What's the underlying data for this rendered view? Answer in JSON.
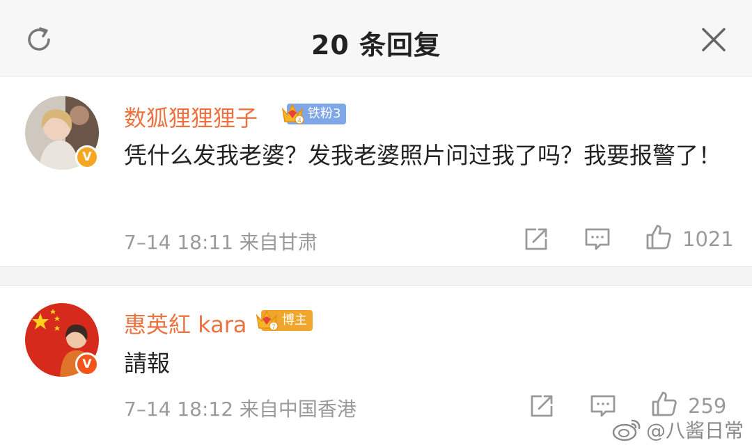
{
  "header": {
    "title": "20 条回复",
    "refresh_icon": "refresh-icon",
    "close_icon": "close-icon"
  },
  "comments": [
    {
      "username": "数狐狸狸狸子",
      "fan_badge": "铁粉3",
      "crown_level": "4",
      "verified_badge": "V",
      "content": "凭什么发我老婆？发我老婆照片问过我了吗？我要报警了！",
      "meta": "7–14 18:11 来自甘肃",
      "likes": "1021",
      "avatar_icon": "user-avatar-photo"
    },
    {
      "username": "惠英紅 kara",
      "fan_badge": "博主",
      "crown_level": "7",
      "verified_badge": "V",
      "content": "請報",
      "meta": "7–14 18:12 来自中国香港",
      "likes": "259",
      "avatar_icon": "user-avatar-flag"
    }
  ],
  "watermark": "@八酱日常",
  "colors": {
    "username": "#eb7340",
    "meta": "#9a9a9a",
    "fan_badge_blue": "#7fa6e8",
    "fan_badge_gold": "#f0a62c",
    "verified_gold": "#f5a623",
    "verified_orange": "#f2541b"
  }
}
